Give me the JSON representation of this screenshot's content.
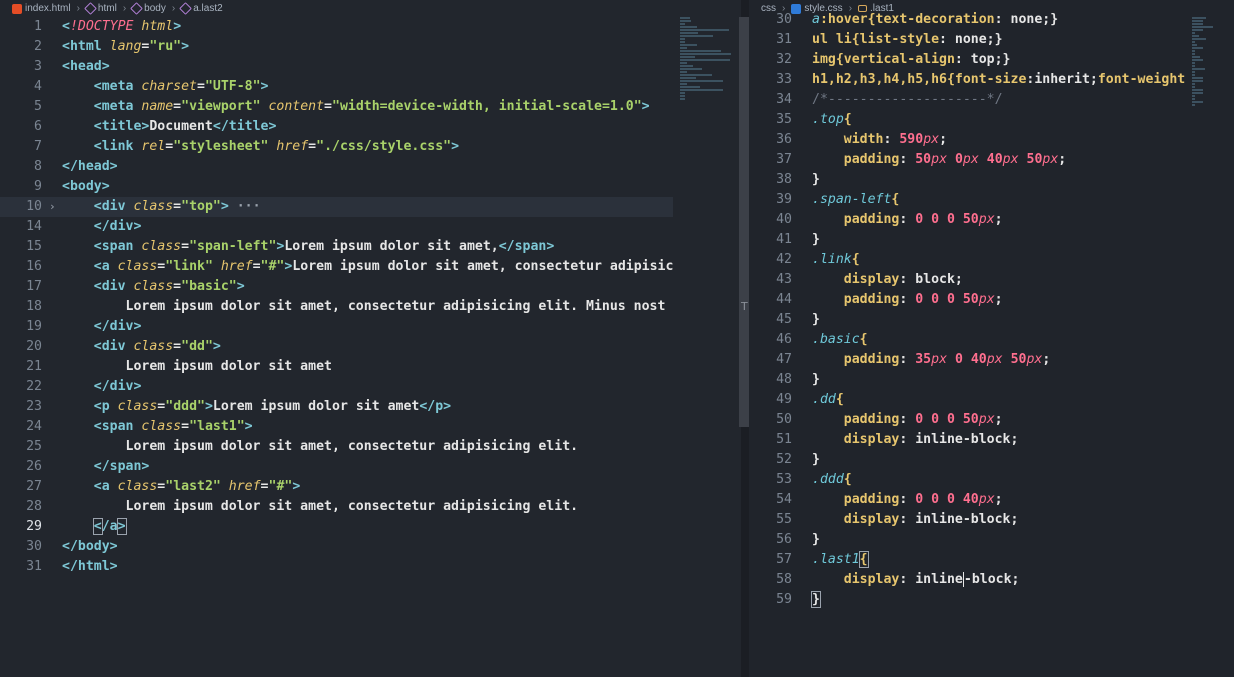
{
  "left_breadcrumb": [
    "index.html",
    "html",
    "body",
    "a.last2"
  ],
  "right_breadcrumb": [
    "css",
    "style.css",
    ".last1"
  ],
  "left_lines": [
    {
      "n": "1",
      "tokens": [
        [
          "t-tag",
          "<"
        ],
        [
          "t-doc",
          "!DOCTYPE "
        ],
        [
          "t-attr",
          "html"
        ],
        [
          "t-tag",
          ">"
        ]
      ]
    },
    {
      "n": "2",
      "tokens": [
        [
          "t-tag",
          "<html "
        ],
        [
          "t-attr",
          "lang"
        ],
        [
          "t-txt",
          "="
        ],
        [
          "t-str",
          "\"ru\""
        ],
        [
          "t-tag",
          ">"
        ]
      ]
    },
    {
      "n": "3",
      "tokens": [
        [
          "t-tag",
          "<head>"
        ]
      ]
    },
    {
      "n": "4",
      "tokens": [
        [
          "t-txt",
          "    "
        ],
        [
          "t-tag",
          "<meta "
        ],
        [
          "t-attr",
          "charset"
        ],
        [
          "t-txt",
          "="
        ],
        [
          "t-str",
          "\"UTF-8\""
        ],
        [
          "t-tag",
          ">"
        ]
      ]
    },
    {
      "n": "5",
      "tokens": [
        [
          "t-txt",
          "    "
        ],
        [
          "t-tag",
          "<meta "
        ],
        [
          "t-attr",
          "name"
        ],
        [
          "t-txt",
          "="
        ],
        [
          "t-str",
          "\"viewport\" "
        ],
        [
          "t-attr",
          "content"
        ],
        [
          "t-txt",
          "="
        ],
        [
          "t-str",
          "\"width=device-width, initial-scale=1.0\""
        ],
        [
          "t-tag",
          ">"
        ]
      ]
    },
    {
      "n": "6",
      "tokens": [
        [
          "t-txt",
          "    "
        ],
        [
          "t-tag",
          "<title>"
        ],
        [
          "t-txt",
          "Document"
        ],
        [
          "t-tag",
          "</title>"
        ]
      ]
    },
    {
      "n": "7",
      "tokens": [
        [
          "t-txt",
          "    "
        ],
        [
          "t-tag",
          "<link "
        ],
        [
          "t-attr",
          "rel"
        ],
        [
          "t-txt",
          "="
        ],
        [
          "t-str",
          "\"stylesheet\" "
        ],
        [
          "t-attr",
          "href"
        ],
        [
          "t-txt",
          "="
        ],
        [
          "t-str",
          "\"./css/style.css\""
        ],
        [
          "t-tag",
          ">"
        ]
      ]
    },
    {
      "n": "8",
      "tokens": [
        [
          "t-tag",
          "</head>"
        ]
      ]
    },
    {
      "n": "9",
      "tokens": [
        [
          "t-tag",
          "<body>"
        ]
      ]
    },
    {
      "n": "10",
      "fold": "›",
      "hl": true,
      "tokens": [
        [
          "t-txt",
          "    "
        ],
        [
          "t-tag",
          "<div "
        ],
        [
          "t-attr",
          "class"
        ],
        [
          "t-txt",
          "="
        ],
        [
          "t-str",
          "\"top\""
        ],
        [
          "t-tag",
          ">"
        ],
        [
          "ellip",
          " ···"
        ]
      ]
    },
    {
      "n": "14",
      "tokens": [
        [
          "t-txt",
          "    "
        ],
        [
          "t-tag",
          "</div>"
        ]
      ]
    },
    {
      "n": "15",
      "tokens": [
        [
          "t-txt",
          "    "
        ],
        [
          "t-tag",
          "<span "
        ],
        [
          "t-attr",
          "class"
        ],
        [
          "t-txt",
          "="
        ],
        [
          "t-str",
          "\"span-left\""
        ],
        [
          "t-tag",
          ">"
        ],
        [
          "t-txt",
          "Lorem ipsum dolor sit amet,"
        ],
        [
          "t-tag",
          "</span>"
        ]
      ]
    },
    {
      "n": "16",
      "tokens": [
        [
          "t-txt",
          "    "
        ],
        [
          "t-tag",
          "<a "
        ],
        [
          "t-attr",
          "class"
        ],
        [
          "t-txt",
          "="
        ],
        [
          "t-str",
          "\"link\" "
        ],
        [
          "t-attr",
          "href"
        ],
        [
          "t-txt",
          "="
        ],
        [
          "t-str",
          "\"#\""
        ],
        [
          "t-tag",
          ">"
        ],
        [
          "t-txt",
          "Lorem ipsum dolor sit amet, consectetur adipisic"
        ]
      ]
    },
    {
      "n": "17",
      "tokens": [
        [
          "t-txt",
          "    "
        ],
        [
          "t-tag",
          "<div "
        ],
        [
          "t-attr",
          "class"
        ],
        [
          "t-txt",
          "="
        ],
        [
          "t-str",
          "\"basic\""
        ],
        [
          "t-tag",
          ">"
        ]
      ]
    },
    {
      "n": "18",
      "tokens": [
        [
          "t-txt",
          "        Lorem ipsum dolor sit amet, consectetur adipisicing elit. Minus nost"
        ]
      ]
    },
    {
      "n": "19",
      "tokens": [
        [
          "t-txt",
          "    "
        ],
        [
          "t-tag",
          "</div>"
        ]
      ]
    },
    {
      "n": "20",
      "tokens": [
        [
          "t-txt",
          "    "
        ],
        [
          "t-tag",
          "<div "
        ],
        [
          "t-attr",
          "class"
        ],
        [
          "t-txt",
          "="
        ],
        [
          "t-str",
          "\"dd\""
        ],
        [
          "t-tag",
          ">"
        ]
      ]
    },
    {
      "n": "21",
      "tokens": [
        [
          "t-txt",
          "        Lorem ipsum dolor sit amet"
        ]
      ]
    },
    {
      "n": "22",
      "tokens": [
        [
          "t-txt",
          "    "
        ],
        [
          "t-tag",
          "</div>"
        ]
      ]
    },
    {
      "n": "23",
      "tokens": [
        [
          "t-txt",
          "    "
        ],
        [
          "t-tag",
          "<p "
        ],
        [
          "t-attr",
          "class"
        ],
        [
          "t-txt",
          "="
        ],
        [
          "t-str",
          "\"ddd\""
        ],
        [
          "t-tag",
          ">"
        ],
        [
          "t-txt",
          "Lorem ipsum dolor sit amet"
        ],
        [
          "t-tag",
          "</p>"
        ]
      ]
    },
    {
      "n": "24",
      "tokens": [
        [
          "t-txt",
          "    "
        ],
        [
          "t-tag",
          "<span "
        ],
        [
          "t-attr",
          "class"
        ],
        [
          "t-txt",
          "="
        ],
        [
          "t-str",
          "\"last1\""
        ],
        [
          "t-tag",
          ">"
        ]
      ]
    },
    {
      "n": "25",
      "tokens": [
        [
          "t-txt",
          "        Lorem ipsum dolor sit amet, consectetur adipisicing elit."
        ]
      ]
    },
    {
      "n": "26",
      "tokens": [
        [
          "t-txt",
          "    "
        ],
        [
          "t-tag",
          "</span>"
        ]
      ]
    },
    {
      "n": "27",
      "tokens": [
        [
          "t-txt",
          "    "
        ],
        [
          "t-tag",
          "<a "
        ],
        [
          "t-attr",
          "class"
        ],
        [
          "t-txt",
          "="
        ],
        [
          "t-str",
          "\"last2\" "
        ],
        [
          "t-attr",
          "href"
        ],
        [
          "t-txt",
          "="
        ],
        [
          "t-str",
          "\"#\""
        ],
        [
          "t-tag",
          ">"
        ]
      ]
    },
    {
      "n": "28",
      "tokens": [
        [
          "t-txt",
          "        Lorem ipsum dolor sit amet, consectetur adipisicing elit."
        ]
      ]
    },
    {
      "n": "29",
      "current": true,
      "tokens": [
        [
          "t-txt",
          "    "
        ],
        [
          "t-tag bracket-box",
          "<"
        ],
        [
          "t-tag",
          "/a"
        ],
        [
          "t-tag bracket-box",
          ">"
        ]
      ]
    },
    {
      "n": "30",
      "tokens": [
        [
          "t-tag",
          "</body>"
        ]
      ]
    },
    {
      "n": "31",
      "tokens": [
        [
          "t-tag",
          "</html>"
        ]
      ]
    }
  ],
  "right_lines": [
    {
      "n": "30",
      "tokens": [
        [
          "t-selc",
          "a"
        ],
        [
          "t-sel",
          ":hover{"
        ],
        [
          "t-prop",
          "text-decoration"
        ],
        [
          "t-val",
          ": none;}"
        ]
      ]
    },
    {
      "n": "31",
      "tokens": [
        [
          "t-sel",
          "ul li{"
        ],
        [
          "t-prop",
          "list-style"
        ],
        [
          "t-val",
          ": none;}"
        ]
      ]
    },
    {
      "n": "32",
      "tokens": [
        [
          "t-sel",
          "img{"
        ],
        [
          "t-prop",
          "vertical-align"
        ],
        [
          "t-val",
          ": top;}"
        ]
      ]
    },
    {
      "n": "33",
      "tokens": [
        [
          "t-sel",
          "h1,h2,h3,h4,h5,h6{"
        ],
        [
          "t-prop",
          "font-size"
        ],
        [
          "t-val",
          ":inherit;"
        ],
        [
          "t-prop",
          "font-weight"
        ]
      ]
    },
    {
      "n": "34",
      "tokens": [
        [
          "t-cmt",
          "/*--------------------*/"
        ]
      ]
    },
    {
      "n": "35",
      "tokens": [
        [
          "t-selc",
          ".top"
        ],
        [
          "t-sel",
          "{"
        ]
      ]
    },
    {
      "n": "36",
      "tokens": [
        [
          "t-txt",
          "    "
        ],
        [
          "t-prop",
          "width"
        ],
        [
          "t-val",
          ": "
        ],
        [
          "t-num",
          "590"
        ],
        [
          "t-unit",
          "px"
        ],
        [
          "t-val",
          ";"
        ]
      ]
    },
    {
      "n": "37",
      "tokens": [
        [
          "t-txt",
          "    "
        ],
        [
          "t-prop",
          "padding"
        ],
        [
          "t-val",
          ": "
        ],
        [
          "t-num",
          "50"
        ],
        [
          "t-unit",
          "px"
        ],
        [
          "t-val",
          " "
        ],
        [
          "t-num",
          "0"
        ],
        [
          "t-unit",
          "px"
        ],
        [
          "t-val",
          " "
        ],
        [
          "t-num",
          "40"
        ],
        [
          "t-unit",
          "px"
        ],
        [
          "t-val",
          " "
        ],
        [
          "t-num",
          "50"
        ],
        [
          "t-unit",
          "px"
        ],
        [
          "t-val",
          ";"
        ]
      ]
    },
    {
      "n": "38",
      "tokens": [
        [
          "t-brace",
          "}"
        ]
      ]
    },
    {
      "n": "39",
      "tokens": [
        [
          "t-selc",
          ".span-left"
        ],
        [
          "t-sel",
          "{"
        ]
      ]
    },
    {
      "n": "40",
      "tokens": [
        [
          "t-txt",
          "    "
        ],
        [
          "t-prop",
          "padding"
        ],
        [
          "t-val",
          ": "
        ],
        [
          "t-num",
          "0 0 0 50"
        ],
        [
          "t-unit",
          "px"
        ],
        [
          "t-val",
          ";"
        ]
      ]
    },
    {
      "n": "41",
      "tokens": [
        [
          "t-brace",
          "}"
        ]
      ]
    },
    {
      "n": "42",
      "tokens": [
        [
          "t-selc",
          ".link"
        ],
        [
          "t-sel",
          "{"
        ]
      ]
    },
    {
      "n": "43",
      "tokens": [
        [
          "t-txt",
          "    "
        ],
        [
          "t-prop",
          "display"
        ],
        [
          "t-val",
          ": block;"
        ]
      ]
    },
    {
      "n": "44",
      "tokens": [
        [
          "t-txt",
          "    "
        ],
        [
          "t-prop",
          "padding"
        ],
        [
          "t-val",
          ": "
        ],
        [
          "t-num",
          "0 0 0 50"
        ],
        [
          "t-unit",
          "px"
        ],
        [
          "t-val",
          ";"
        ]
      ]
    },
    {
      "n": "45",
      "tokens": [
        [
          "t-brace",
          "}"
        ]
      ]
    },
    {
      "n": "46",
      "tokens": [
        [
          "t-selc",
          ".basic"
        ],
        [
          "t-sel",
          "{"
        ]
      ]
    },
    {
      "n": "47",
      "tokens": [
        [
          "t-txt",
          "    "
        ],
        [
          "t-prop",
          "padding"
        ],
        [
          "t-val",
          ": "
        ],
        [
          "t-num",
          "35"
        ],
        [
          "t-unit",
          "px"
        ],
        [
          "t-val",
          " "
        ],
        [
          "t-num",
          "0 40"
        ],
        [
          "t-unit",
          "px"
        ],
        [
          "t-val",
          " "
        ],
        [
          "t-num",
          "50"
        ],
        [
          "t-unit",
          "px"
        ],
        [
          "t-val",
          ";"
        ]
      ]
    },
    {
      "n": "48",
      "tokens": [
        [
          "t-brace",
          "}"
        ]
      ]
    },
    {
      "n": "49",
      "tokens": [
        [
          "t-selc",
          ".dd"
        ],
        [
          "t-sel",
          "{"
        ]
      ]
    },
    {
      "n": "50",
      "tokens": [
        [
          "t-txt",
          "    "
        ],
        [
          "t-prop",
          "padding"
        ],
        [
          "t-val",
          ": "
        ],
        [
          "t-num",
          "0 0 0 50"
        ],
        [
          "t-unit",
          "px"
        ],
        [
          "t-val",
          ";"
        ]
      ]
    },
    {
      "n": "51",
      "tokens": [
        [
          "t-txt",
          "    "
        ],
        [
          "t-prop",
          "display"
        ],
        [
          "t-val",
          ": inline-block;"
        ]
      ]
    },
    {
      "n": "52",
      "tokens": [
        [
          "t-brace",
          "}"
        ]
      ]
    },
    {
      "n": "53",
      "tokens": [
        [
          "t-selc",
          ".ddd"
        ],
        [
          "t-sel",
          "{"
        ]
      ]
    },
    {
      "n": "54",
      "tokens": [
        [
          "t-txt",
          "    "
        ],
        [
          "t-prop",
          "padding"
        ],
        [
          "t-val",
          ": "
        ],
        [
          "t-num",
          "0 0 0 40"
        ],
        [
          "t-unit",
          "px"
        ],
        [
          "t-val",
          ";"
        ]
      ]
    },
    {
      "n": "55",
      "tokens": [
        [
          "t-txt",
          "    "
        ],
        [
          "t-prop",
          "display"
        ],
        [
          "t-val",
          ": inline-block;"
        ]
      ]
    },
    {
      "n": "56",
      "tokens": [
        [
          "t-brace",
          "}"
        ]
      ]
    },
    {
      "n": "57",
      "tokens": [
        [
          "t-selc",
          ".last1"
        ],
        [
          "t-sel bracket-box",
          "{"
        ]
      ]
    },
    {
      "n": "58",
      "tokens": [
        [
          "t-txt",
          "    "
        ],
        [
          "t-prop",
          "display"
        ],
        [
          "t-val",
          ": inline"
        ],
        [
          "cursor",
          ""
        ],
        [
          "t-val",
          "-block;"
        ]
      ]
    },
    {
      "n": "59",
      "tokens": [
        [
          "t-brace bracket-box",
          "}"
        ]
      ]
    }
  ],
  "colors": {
    "background": "#22262d",
    "tag": "#7ec8d6",
    "attribute": "#e7c66e",
    "string": "#a9d26a",
    "number": "#ff6f8f"
  }
}
